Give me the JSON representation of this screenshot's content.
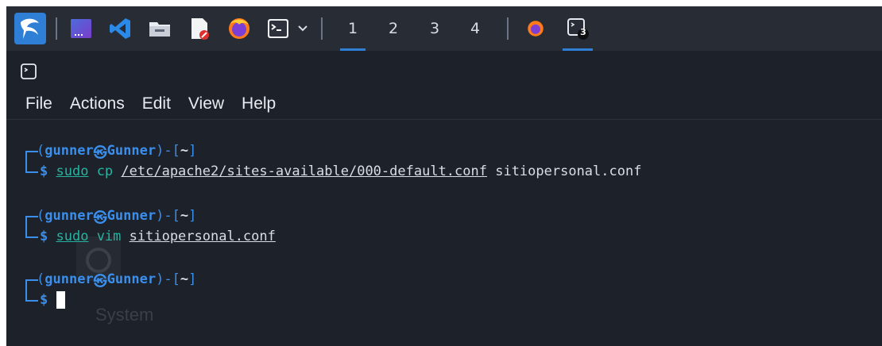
{
  "workspaces": [
    "1",
    "2",
    "3",
    "4"
  ],
  "active_workspace": "1",
  "taskbar": {
    "terminal_badge": "3"
  },
  "menu": [
    "File",
    "Actions",
    "Edit",
    "View",
    "Help"
  ],
  "background_text": "System",
  "terminal": {
    "prompts": [
      {
        "open": "(",
        "user": "gunner",
        "at_symbol": "㉿",
        "host": "Gunner",
        "close": ")-[",
        "dir": "~",
        "end": "]",
        "dollar": "$",
        "cmd": "sudo",
        "args_plain": " cp ",
        "args_path": "/etc/apache2/sites-available/000-default.conf",
        "args_rest": " sitiopersonal.conf"
      },
      {
        "open": "(",
        "user": "gunner",
        "at_symbol": "㉿",
        "host": "Gunner",
        "close": ")-[",
        "dir": "~",
        "end": "]",
        "dollar": "$",
        "cmd": "sudo",
        "args_plain": " vim ",
        "args_path": "sitiopersonal.conf",
        "args_rest": ""
      },
      {
        "open": "(",
        "user": "gunner",
        "at_symbol": "㉿",
        "host": "Gunner",
        "close": ")-[",
        "dir": "~",
        "end": "]",
        "dollar": "$"
      }
    ]
  },
  "colors": {
    "background": "#1d2129",
    "taskbar": "#272c35",
    "accent": "#2f7fd6",
    "prompt": "#3b8eea",
    "command": "#26b3a1"
  }
}
